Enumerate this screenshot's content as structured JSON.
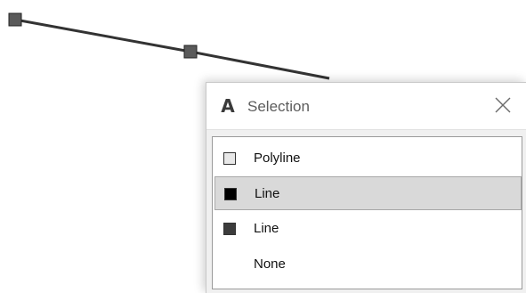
{
  "dialog": {
    "app_icon": "autocad-a-icon",
    "app_icon_glyph": "A",
    "title": "Selection",
    "close_icon": "close-icon"
  },
  "selection_list": {
    "items": [
      {
        "label": "Polyline",
        "swatch_color": "#e8e8e8",
        "selected": false
      },
      {
        "label": "Line",
        "swatch_color": "#000000",
        "selected": true
      },
      {
        "label": "Line",
        "swatch_color": "#3c3c3c",
        "selected": false
      },
      {
        "label": "None",
        "swatch_color": null,
        "selected": false
      }
    ]
  },
  "colors": {
    "polyline_stroke": "#333333",
    "grip_fill": "#5a5a5a",
    "selected_row_bg": "#d9d9d9"
  }
}
